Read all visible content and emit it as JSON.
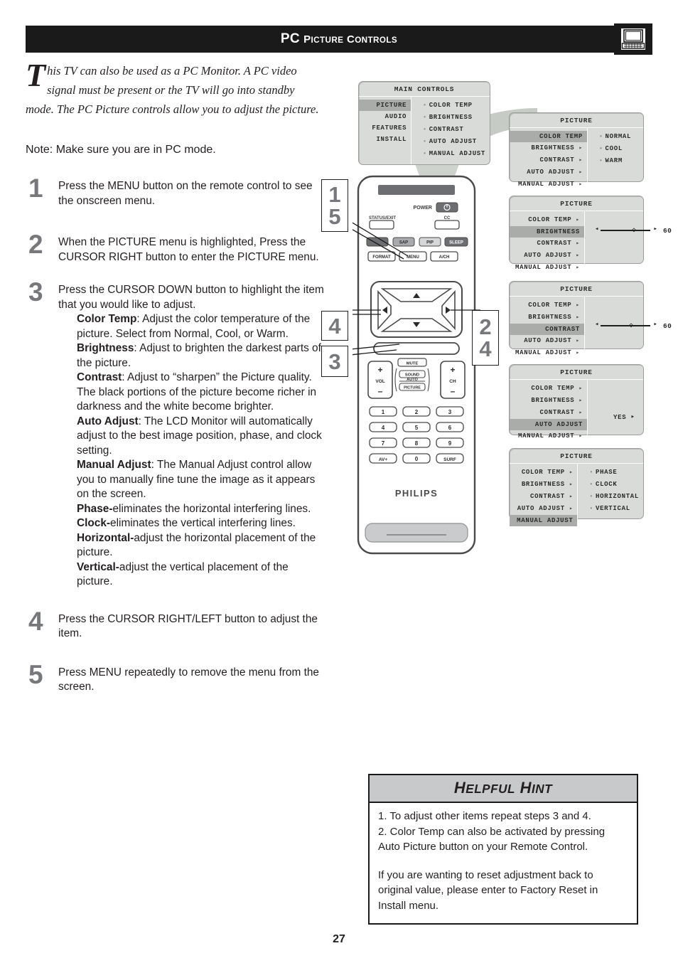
{
  "header": {
    "title_main": "PC",
    "title_rest": "PICTURE CONTROLS",
    "icon": "pc-monitor-icon"
  },
  "intro": {
    "dropcap": "T",
    "text": "his TV can also be used as a PC Monitor. A PC video signal must be present or the TV will go into standby mode. The PC Picture controls allow you to adjust the picture."
  },
  "note": "Note: Make sure you are in PC mode.",
  "steps": [
    {
      "number": "1",
      "text": "Press the MENU button on the remote control to see the onscreen menu."
    },
    {
      "number": "2",
      "text": "When the PICTURE menu is highlighted, Press the CURSOR RIGHT button to enter the PICTURE menu."
    },
    {
      "number": "3",
      "text": "Press the CURSOR DOWN button to highlight the item that you would like to adjust.",
      "sub_items": [
        {
          "term": "Color Temp",
          "sep": ": ",
          "desc": "Adjust the color temperature of the picture. Select from Normal, Cool, or Warm."
        },
        {
          "term": "Brightness",
          "sep": ": ",
          "desc": "Adjust to brighten the darkest parts of the picture."
        },
        {
          "term": "Contrast",
          "sep": ": ",
          "desc": "Adjust to “sharpen” the Picture quality. The black portions of the picture become richer in darkness and the white become brighter."
        },
        {
          "term": "Auto Adjust",
          "sep": ": ",
          "desc": "The LCD Monitor will automatically adjust to the best image position, phase, and clock setting."
        },
        {
          "term": "Manual Adjust",
          "sep": ": ",
          "desc": "The Manual Adjust control allow you to manually fine tune the image as it appears on the screen."
        },
        {
          "term": "Phase-",
          "sep": "",
          "desc": "eliminates the horizontal interfering lines."
        },
        {
          "term": "Clock-",
          "sep": "",
          "desc": "eliminates the vertical interfering lines."
        },
        {
          "term": "Horizontal-",
          "sep": "",
          "desc": "adjust the horizontal placement of the picture."
        },
        {
          "term": "Vertical-",
          "sep": "",
          "desc": "adjust the vertical placement of the picture."
        }
      ]
    },
    {
      "number": "4",
      "text": "Press the CURSOR RIGHT/LEFT button to adjust the item."
    },
    {
      "number": "5",
      "text": "Press MENU repeatedly to remove the menu from the screen."
    }
  ],
  "osd": {
    "main_controls": {
      "title": "MAIN CONTROLS",
      "left_items": [
        {
          "label": "PICTURE",
          "selected": true
        },
        {
          "label": "AUDIO",
          "selected": false
        },
        {
          "label": "FEATURES",
          "selected": false
        },
        {
          "label": "INSTALL",
          "selected": false
        }
      ],
      "right_items": [
        "COLOR TEMP",
        "BRIGHTNESS",
        "CONTRAST",
        "AUTO ADJUST",
        "MANUAL ADJUST"
      ]
    },
    "picture_color_temp": {
      "title": "PICTURE",
      "left_items": [
        {
          "label": "COLOR TEMP",
          "selected": true,
          "arrow": false
        },
        {
          "label": "BRIGHTNESS",
          "selected": false,
          "arrow": true
        },
        {
          "label": "CONTRAST",
          "selected": false,
          "arrow": true
        },
        {
          "label": "AUTO ADJUST",
          "selected": false,
          "arrow": true
        },
        {
          "label": "MANUAL ADJUST",
          "selected": false,
          "arrow": true
        }
      ],
      "right_items": [
        "NORMAL",
        "COOL",
        "WARM"
      ]
    },
    "picture_brightness": {
      "title": "PICTURE",
      "left_items": [
        {
          "label": "COLOR TEMP",
          "selected": false,
          "arrow": true
        },
        {
          "label": "BRIGHTNESS",
          "selected": true,
          "arrow": false
        },
        {
          "label": "CONTRAST",
          "selected": false,
          "arrow": true
        },
        {
          "label": "AUTO ADJUST",
          "selected": false,
          "arrow": true
        },
        {
          "label": "MANUAL ADJUST",
          "selected": false,
          "arrow": true
        }
      ],
      "slider_value": "60",
      "slider_percent": 58
    },
    "picture_contrast": {
      "title": "PICTURE",
      "left_items": [
        {
          "label": "COLOR TEMP",
          "selected": false,
          "arrow": true
        },
        {
          "label": "BRIGHTNESS",
          "selected": false,
          "arrow": true
        },
        {
          "label": "CONTRAST",
          "selected": true,
          "arrow": false
        },
        {
          "label": "AUTO ADJUST",
          "selected": false,
          "arrow": true
        },
        {
          "label": "MANUAL ADJUST",
          "selected": false,
          "arrow": true
        }
      ],
      "slider_value": "60",
      "slider_percent": 55
    },
    "picture_auto_adjust": {
      "title": "PICTURE",
      "left_items": [
        {
          "label": "COLOR TEMP",
          "selected": false,
          "arrow": true
        },
        {
          "label": "BRIGHTNESS",
          "selected": false,
          "arrow": true
        },
        {
          "label": "CONTRAST",
          "selected": false,
          "arrow": true
        },
        {
          "label": "AUTO ADJUST",
          "selected": true,
          "arrow": false
        },
        {
          "label": "MANUAL ADJUST",
          "selected": false,
          "arrow": true
        }
      ],
      "value": "YES ‣"
    },
    "picture_manual_adjust": {
      "title": "PICTURE",
      "left_items": [
        {
          "label": "COLOR TEMP",
          "selected": false,
          "arrow": true
        },
        {
          "label": "BRIGHTNESS",
          "selected": false,
          "arrow": true
        },
        {
          "label": "CONTRAST",
          "selected": false,
          "arrow": true
        },
        {
          "label": "AUTO ADJUST",
          "selected": false,
          "arrow": true
        },
        {
          "label": "MANUAL ADJUST",
          "selected": true,
          "arrow": false
        }
      ],
      "right_items": [
        "PHASE",
        "CLOCK",
        "HORIZONTAL",
        "VERTICAL"
      ]
    }
  },
  "callouts": [
    {
      "id": "co-15",
      "lines": [
        "1",
        "5"
      ]
    },
    {
      "id": "co-4",
      "lines": [
        "4"
      ]
    },
    {
      "id": "co-3",
      "lines": [
        "3"
      ]
    },
    {
      "id": "co-24",
      "lines": [
        "2",
        "4"
      ]
    }
  ],
  "remote": {
    "brand": "PHILIPS",
    "power_label": "POWER",
    "buttons": {
      "status_exit": "STATUS/EXIT",
      "cc": "CC",
      "sap": "SAP",
      "pip": "PIP",
      "sleep": "SLEEP",
      "format": "FORMAT",
      "menu": "MENU",
      "ach": "A/CH",
      "mute": "MUTE",
      "sound": "SOUND",
      "auto": "AUTO",
      "picture": "PICTURE",
      "vol": "VOL",
      "ch": "CH",
      "plus": "+",
      "minus": "–",
      "av": "AV+",
      "surf": "SURF"
    },
    "keypad": [
      "1",
      "2",
      "3",
      "4",
      "5",
      "6",
      "7",
      "8",
      "9",
      "AV+",
      "0",
      "SURF"
    ]
  },
  "hint": {
    "title_main": "H",
    "title": "HELPFUL HINT",
    "line1": "1. To adjust other items repeat steps 3 and 4.",
    "line2": "2. Color Temp can also be activated by pressing Auto Picture button on your Remote Control.",
    "line3": "If you are wanting to reset adjustment back to original value, please enter to Factory Reset in Install menu."
  },
  "page_number": "27",
  "colors": {
    "header_bg": "#1a1a1a",
    "step_number": "#77787b",
    "osd_bg": "#d9dbd8",
    "osd_selected": "#a9aca8",
    "hint_head_bg": "#c8c9ca"
  }
}
